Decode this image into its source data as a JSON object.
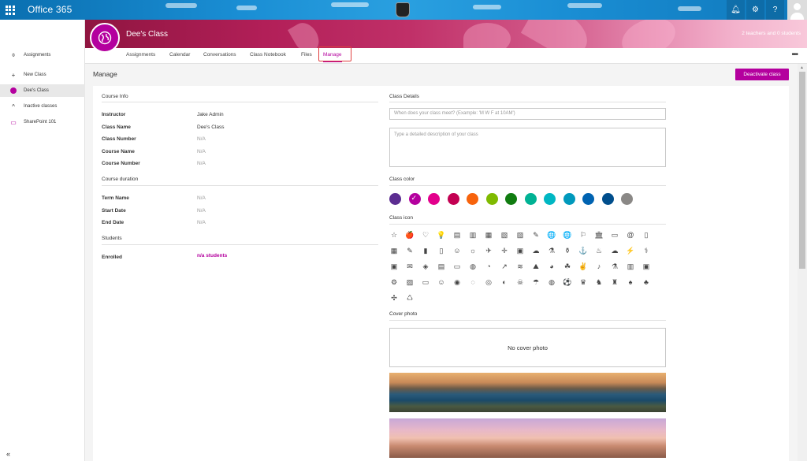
{
  "app": {
    "brand": "Office 365"
  },
  "topbar": {
    "icons": [
      "bell-icon",
      "gear-icon",
      "help-icon"
    ],
    "help_glyph": "?"
  },
  "leftnav": {
    "items": [
      {
        "label": "Assignments",
        "icon": "assignments-icon"
      },
      {
        "label": "New Class",
        "icon": "plus-icon"
      },
      {
        "label": "Dee's Class",
        "icon": "class-dot-icon",
        "selected": true
      },
      {
        "label": "Inactive classes",
        "icon": "chevron-up-icon"
      },
      {
        "label": "SharePoint 101",
        "icon": "class-card-icon"
      }
    ],
    "collapse": "«"
  },
  "header": {
    "class_name": "Dee's Class",
    "stats": "2 teachers and 0 students"
  },
  "tabs": [
    {
      "label": "Assignments"
    },
    {
      "label": "Calendar"
    },
    {
      "label": "Conversations"
    },
    {
      "label": "Class Notebook"
    },
    {
      "label": "Files"
    },
    {
      "label": "Manage",
      "active": true
    }
  ],
  "more": "•••",
  "manage": {
    "heading": "Manage",
    "deactivate_label": "Deactivate class"
  },
  "course_info": {
    "heading": "Course Info",
    "rows": [
      {
        "label": "Instructor",
        "value": "Jake Admin"
      },
      {
        "label": "Class Name",
        "value": "Dee's Class"
      },
      {
        "label": "Class Number",
        "value": "N/A"
      },
      {
        "label": "Course Name",
        "value": "N/A"
      },
      {
        "label": "Course Number",
        "value": "N/A"
      }
    ]
  },
  "course_duration": {
    "heading": "Course duration",
    "rows": [
      {
        "label": "Term Name",
        "value": "N/A"
      },
      {
        "label": "Start Date",
        "value": "N/A"
      },
      {
        "label": "End Date",
        "value": "N/A"
      }
    ]
  },
  "students": {
    "heading": "Students",
    "label": "Enrolled",
    "value": "n/a students"
  },
  "class_details": {
    "heading": "Class Details",
    "schedule_placeholder": "When does your class meet? (Example: 'M W F at 10AM')",
    "description_placeholder": "Type a detailed description of your class"
  },
  "class_color": {
    "heading": "Class color",
    "colors": [
      "#5c2d91",
      "#b4009e",
      "#e3008c",
      "#c30052",
      "#f7630c",
      "#7fba00",
      "#107c10",
      "#00b294",
      "#00b7c3",
      "#0099bc",
      "#0063b1",
      "#004e8c",
      "#8a8886"
    ],
    "selected_index": 1
  },
  "class_icon": {
    "heading": "Class icon",
    "icons": [
      "☆",
      "🍎",
      "♡",
      "💡",
      "▤",
      "▥",
      "▦",
      "▧",
      "▨",
      "✎",
      "🌐",
      "🌐",
      "⚐",
      "🏛",
      "▭",
      "@",
      "▯",
      "▦",
      "✎",
      "▮",
      "▯",
      "☺",
      "☼",
      "✈",
      "✛",
      "▣",
      "☁",
      "⚗",
      "⚱",
      "⚓",
      "♨",
      "☁",
      "⚡",
      "⚕",
      "▣",
      "✉",
      "◈",
      "▤",
      "▭",
      "◍",
      "◔",
      "↗",
      "≋",
      "⛰",
      "◕",
      "☘",
      "✌",
      "♪",
      "⚗",
      "▥",
      "▣",
      "⚙",
      "▨",
      "▭",
      "☺",
      "◉",
      "◌",
      "◎",
      "◐",
      "☠",
      "☂",
      "◍",
      "⚽",
      "♛",
      "♞",
      "♜",
      "♠",
      "♣",
      "✣",
      "♺"
    ],
    "selected_index": 11
  },
  "cover_photo": {
    "heading": "Cover photo",
    "none_label": "No cover photo"
  }
}
